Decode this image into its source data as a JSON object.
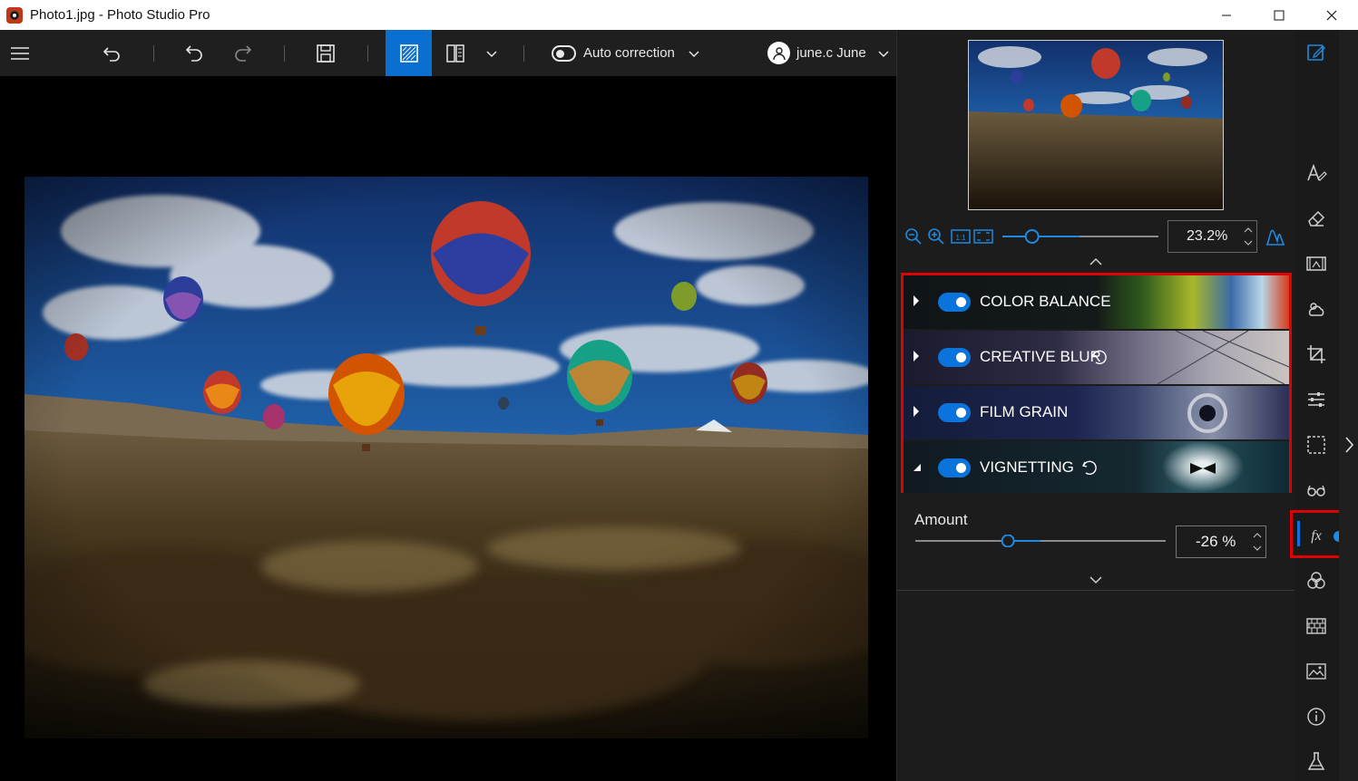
{
  "window": {
    "title": "Photo1.jpg - Photo Studio Pro"
  },
  "toolbar": {
    "auto_correction_label": "Auto correction",
    "user_name": "june.c June"
  },
  "navigator": {
    "zoom_value": "23.2%",
    "zoom_slider_fraction": 0.19
  },
  "effects": [
    {
      "label": "COLOR BALANCE",
      "enabled": true,
      "expanded": false,
      "has_reset": false
    },
    {
      "label": "CREATIVE BLUR",
      "enabled": true,
      "expanded": false,
      "has_reset": true
    },
    {
      "label": "FILM GRAIN",
      "enabled": true,
      "expanded": false,
      "has_reset": false
    },
    {
      "label": "VIGNETTING",
      "enabled": true,
      "expanded": true,
      "has_reset": true
    }
  ],
  "vignetting": {
    "amount_label": "Amount",
    "amount_value": "-26 %",
    "amount_percent": -26
  },
  "colors": {
    "accent": "#0b74dc",
    "highlight": "#e00000",
    "panel": "#1c1c1c"
  },
  "side_tools": [
    "edit-icon",
    "text-style-icon",
    "eraser-icon",
    "filmstrip-icon",
    "weather-icon",
    "crop-icon",
    "adjust-icon",
    "selection-icon",
    "glasses-icon",
    "fx-icon",
    "color-circles-icon",
    "texture-icon",
    "image-icon",
    "info-icon",
    "lab-flask-icon"
  ]
}
